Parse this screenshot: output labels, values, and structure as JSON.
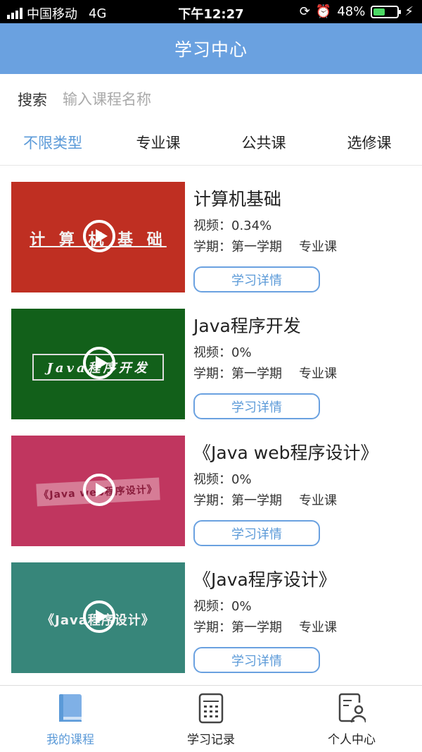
{
  "status_bar": {
    "carrier": "中国移动",
    "network": "4G",
    "time": "下午12:27",
    "battery": "48%",
    "battery_fill": 0.48
  },
  "header": {
    "title": "学习中心"
  },
  "search": {
    "label": "搜索",
    "placeholder": "输入课程名称"
  },
  "filters": [
    {
      "label": "不限类型",
      "active": true
    },
    {
      "label": "专业课",
      "active": false
    },
    {
      "label": "公共课",
      "active": false
    },
    {
      "label": "选修课",
      "active": false
    }
  ],
  "courses": [
    {
      "title": "计算机基础",
      "thumb_text": "计 算 机 基 础",
      "thumb_color": "#bf2f22",
      "video_label": "视频：",
      "video_value": "0.34%",
      "term_label": "学期：",
      "term_value": "第一学期",
      "type": "专业课",
      "button": "学习详情"
    },
    {
      "title": "Java程序开发",
      "thumb_text": "Java程序开发",
      "thumb_color": "#12601a",
      "video_label": "视频：",
      "video_value": "0%",
      "term_label": "学期：",
      "term_value": "第一学期",
      "type": "专业课",
      "button": "学习详情"
    },
    {
      "title": "《Java web程序设计》",
      "thumb_text": "《Java web程序设计》",
      "thumb_color": "#c0365f",
      "video_label": "视频：",
      "video_value": "0%",
      "term_label": "学期：",
      "term_value": "第一学期",
      "type": "专业课",
      "button": "学习详情"
    },
    {
      "title": "《Java程序设计》",
      "thumb_text": "《Java程序设计》",
      "thumb_color": "#37867a",
      "video_label": "视频：",
      "video_value": "0%",
      "term_label": "学期：",
      "term_value": "第一学期",
      "type": "专业课",
      "button": "学习详情"
    }
  ],
  "tabbar": [
    {
      "label": "我的课程",
      "icon": "book-icon",
      "active": true
    },
    {
      "label": "学习记录",
      "icon": "calculator-icon",
      "active": false
    },
    {
      "label": "个人中心",
      "icon": "person-file-icon",
      "active": false
    }
  ],
  "colors": {
    "accent": "#6aa1e0",
    "active_text": "#5b9ad8"
  }
}
